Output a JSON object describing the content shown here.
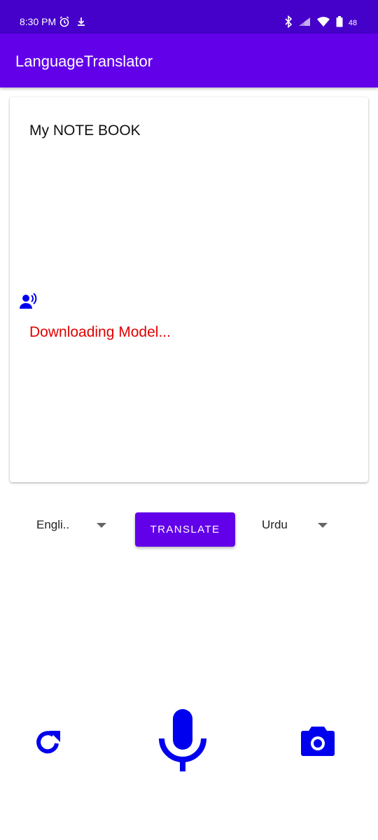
{
  "status_bar": {
    "time": "8:30 PM",
    "battery": "48",
    "icons": [
      "alarm-icon",
      "download-icon",
      "bluetooth-icon",
      "signal-icon",
      "wifi-icon",
      "battery-icon"
    ]
  },
  "app_bar": {
    "title": "LanguageTranslator"
  },
  "card": {
    "note_text": "My NOTE BOOK",
    "status_text": "Downloading Model...",
    "speaker_icon": "record-voice-icon"
  },
  "controls": {
    "source_language": "Engli..",
    "target_language": "Urdu",
    "translate_label": "TRANSLATE"
  },
  "bottom_bar": {
    "icons": [
      "refresh-icon",
      "microphone-icon",
      "camera-icon"
    ]
  },
  "colors": {
    "status_bar": "#4500c9",
    "primary": "#6200ea",
    "icon_blue": "#0000ee",
    "error_red": "#e00000"
  }
}
